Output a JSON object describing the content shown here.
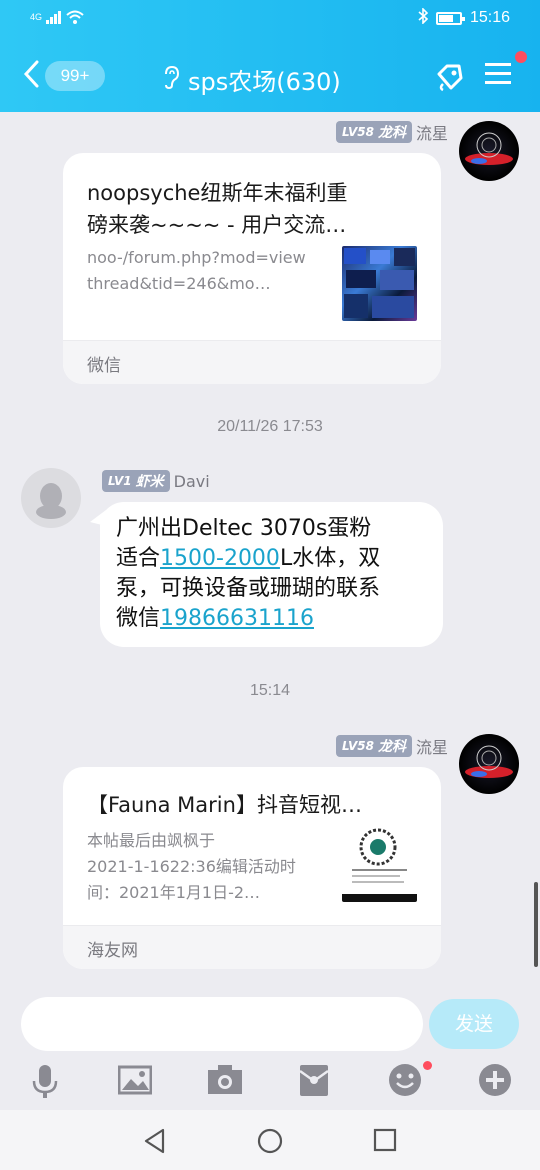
{
  "status": {
    "network": "4G",
    "time": "15:16"
  },
  "header": {
    "back_symbol": "<",
    "unread_badge": "99+",
    "group_title": "sps农场(630)",
    "icons": [
      "back-arrow-icon",
      "ear-icon",
      "tag-icon",
      "menu-icon"
    ]
  },
  "messages": [
    {
      "sender": {
        "level": "LV58",
        "rank": "龙科",
        "name": "流星"
      },
      "card": {
        "title": "noopsyche纽斯年末福利重磅来袭~~~~ - 用户交流…",
        "title_line1": "noopsyche纽斯年末福利重",
        "title_line2": "磅来袭~~~~ - 用户交流…",
        "desc_line1": "noo-/forum.php?mod=view",
        "desc_line2": "thread&tid=246&mo…",
        "source": "微信"
      }
    },
    {
      "timestamp": "20/11/26 17:53"
    },
    {
      "sender": {
        "level": "LV1",
        "rank": "虾米",
        "name": "Davi"
      },
      "text": {
        "line1": "广州出Deltec 3070s蛋粉",
        "line2_pre": "适合",
        "line2_link": "1500-2000",
        "line2_post": "L水体，双",
        "line3": "泵，可换设备或珊瑚的联系",
        "line4_pre": "微信",
        "line4_link": "19866631116"
      }
    },
    {
      "timestamp": "15:14"
    },
    {
      "sender": {
        "level": "LV58",
        "rank": "龙科",
        "name": "流星"
      },
      "card": {
        "title": "【Fauna Marin】抖音短视…",
        "desc_line1": "本帖最后由飒枫于",
        "desc_line2": "2021-1-1622:36编辑活动时",
        "desc_line3": "间：2021年1月1日-2…",
        "source": "海友网"
      }
    }
  ],
  "input": {
    "placeholder": "",
    "send_label": "发送"
  },
  "toolbar_icons": [
    "microphone-icon",
    "image-icon",
    "camera-icon",
    "red-packet-icon",
    "emoji-icon",
    "plus-icon"
  ],
  "colors": {
    "header_start": "#2fc8f5",
    "header_end": "#17b3ef",
    "link": "#1aa3cc",
    "badge_red": "#ff4d5e",
    "send_button": "#b6eaf9"
  }
}
